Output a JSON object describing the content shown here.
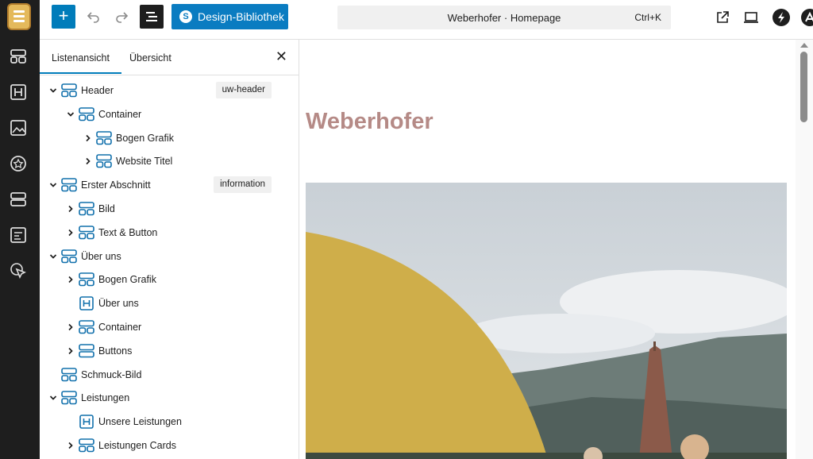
{
  "toolbar": {
    "add_label": "+",
    "design_library_label": "Design-Bibliothek",
    "command_title": "Weberhofer · Homepage",
    "command_shortcut": "Ctrl+K"
  },
  "panel": {
    "tabs": [
      {
        "label": "Listenansicht",
        "active": true
      },
      {
        "label": "Übersicht",
        "active": false
      }
    ],
    "close_label": "✕"
  },
  "list": [
    {
      "label": "Header",
      "level": 0,
      "expanded": true,
      "has_children": true,
      "icon": "group-icon",
      "badge": "uw-header"
    },
    {
      "label": "Container",
      "level": 1,
      "expanded": true,
      "has_children": true,
      "icon": "group-icon"
    },
    {
      "label": "Bogen Grafik",
      "level": 2,
      "expanded": false,
      "has_children": true,
      "icon": "group-icon"
    },
    {
      "label": "Website Titel",
      "level": 2,
      "expanded": false,
      "has_children": true,
      "icon": "group-icon"
    },
    {
      "label": "Erster Abschnitt",
      "level": 0,
      "expanded": true,
      "has_children": true,
      "icon": "group-icon",
      "badge": "information"
    },
    {
      "label": "Bild",
      "level": 1,
      "expanded": false,
      "has_children": true,
      "icon": "group-icon"
    },
    {
      "label": "Text & Button",
      "level": 1,
      "expanded": false,
      "has_children": true,
      "icon": "group-icon"
    },
    {
      "label": "Über uns",
      "level": 0,
      "expanded": true,
      "has_children": true,
      "icon": "group-icon"
    },
    {
      "label": "Bogen Grafik",
      "level": 1,
      "expanded": false,
      "has_children": true,
      "icon": "group-icon"
    },
    {
      "label": "Über uns",
      "level": 1,
      "expanded": false,
      "has_children": false,
      "icon": "heading-icon"
    },
    {
      "label": "Container",
      "level": 1,
      "expanded": false,
      "has_children": true,
      "icon": "group-icon"
    },
    {
      "label": "Buttons",
      "level": 1,
      "expanded": false,
      "has_children": true,
      "icon": "buttons-icon"
    },
    {
      "label": "Schmuck-Bild",
      "level": 0,
      "expanded": false,
      "has_children": false,
      "icon": "group-icon"
    },
    {
      "label": "Leistungen",
      "level": 0,
      "expanded": true,
      "has_children": true,
      "icon": "group-icon"
    },
    {
      "label": "Unsere Leistungen",
      "level": 1,
      "expanded": false,
      "has_children": false,
      "icon": "heading-icon"
    },
    {
      "label": "Leistungen Cards",
      "level": 1,
      "expanded": false,
      "has_children": true,
      "icon": "group-icon"
    }
  ],
  "canvas": {
    "site_title": "Weberhofer"
  },
  "colors": {
    "accent": "#007cba",
    "title": "#b58a86",
    "arc": "#cfae4a"
  }
}
